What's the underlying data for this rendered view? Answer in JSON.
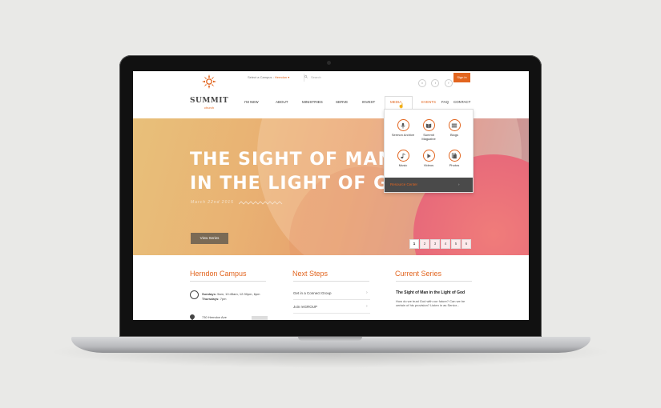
{
  "header": {
    "campus_prefix": "Select a Campus :",
    "campus_value": "Herndon",
    "search_placeholder": "Search",
    "social_icons": [
      "vimeo-icon",
      "twitter-icon",
      "facebook-icon"
    ],
    "social_glyphs": [
      "v",
      "t",
      "f"
    ],
    "signin_label": "Sign in"
  },
  "brand": {
    "name": "SUMMIT",
    "sub": "church",
    "accent": "#e2651f"
  },
  "nav": {
    "items": [
      "I'M NEW",
      "ABOUT",
      "MINISTRIES",
      "SERVE",
      "INVEST",
      "MEDIA",
      "EVENTS",
      "FAQ",
      "CONTACT"
    ]
  },
  "media_menu": {
    "items": [
      {
        "label": "Sermon Archive",
        "icon": "microphone-icon"
      },
      {
        "label": "Summit Magazine",
        "icon": "book-icon"
      },
      {
        "label": "Blogs",
        "icon": "list-icon"
      },
      {
        "label": "Music",
        "icon": "music-note-icon"
      },
      {
        "label": "Videos",
        "icon": "play-icon"
      },
      {
        "label": "Photos",
        "icon": "photos-icon"
      }
    ],
    "footer_label": "Resource Center",
    "footer_arrow": "›"
  },
  "hero": {
    "title_line1": "THE SIGHT OF MAN",
    "title_line2": "IN THE LIGHT OF GOD",
    "date": "March 22nd 2015",
    "button_label": "View Series",
    "pages": [
      "1",
      "2",
      "3",
      "4",
      "5",
      "6"
    ],
    "active_page": "1"
  },
  "campus_section": {
    "title": "Herndon Campus",
    "sundays_label": "Sundays:",
    "sundays_times": "9am, 10:45am, 12:30pm, 6pm",
    "thursdays_label": "Thursdays:",
    "thursdays_times": "7pm",
    "address": "730 Herndon Ave"
  },
  "next_steps": {
    "title": "Next Steps",
    "items": [
      "Get in a Connect Group",
      "Join reGROUP"
    ],
    "arrow": "›"
  },
  "current_series": {
    "title": "Current Series",
    "series_title": "The Sight of Man in the Light of God",
    "description": "How do we trust God with our future? Can we be certain of his provision? Listen in as Senior..."
  }
}
